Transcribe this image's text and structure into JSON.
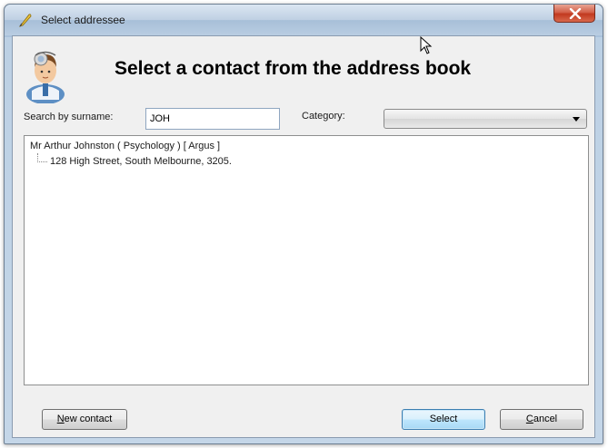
{
  "window": {
    "title": "Select addressee"
  },
  "header": {
    "heading": "Select a contact from the address book"
  },
  "search": {
    "label": "Search by surname:",
    "value": "JOH"
  },
  "category": {
    "label": "Category:",
    "selected": ""
  },
  "results": {
    "contact": {
      "line": "Mr Arthur Johnston  ( Psychology )  [ Argus ]",
      "address": "128 High Street, South Melbourne, 3205."
    }
  },
  "buttons": {
    "new_contact_first": "N",
    "new_contact_rest": "ew contact",
    "select": "Select",
    "cancel_first": "C",
    "cancel_rest": "ancel"
  },
  "colors": {
    "frame": "#bfd2e6",
    "close": "#c2391f",
    "default_button": "#bee6fd"
  },
  "icons": [
    "quill-icon",
    "close-icon",
    "doctor-icon",
    "chevron-down-icon",
    "mouse-pointer-icon"
  ]
}
